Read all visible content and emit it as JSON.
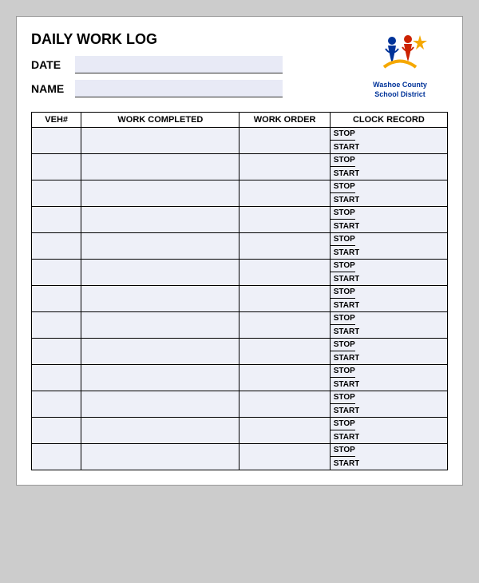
{
  "title": "DAILY WORK LOG",
  "fields": {
    "date_label": "DATE",
    "name_label": "NAME"
  },
  "logo": {
    "line1": "Washoe County",
    "line2": "School District"
  },
  "columns": {
    "veh": "VEH#",
    "work": "WORK COMPLETED",
    "order": "WORK ORDER",
    "clock": "CLOCK RECORD"
  },
  "clock_labels": {
    "stop": "STOP",
    "start": "START"
  },
  "row_count": 13
}
